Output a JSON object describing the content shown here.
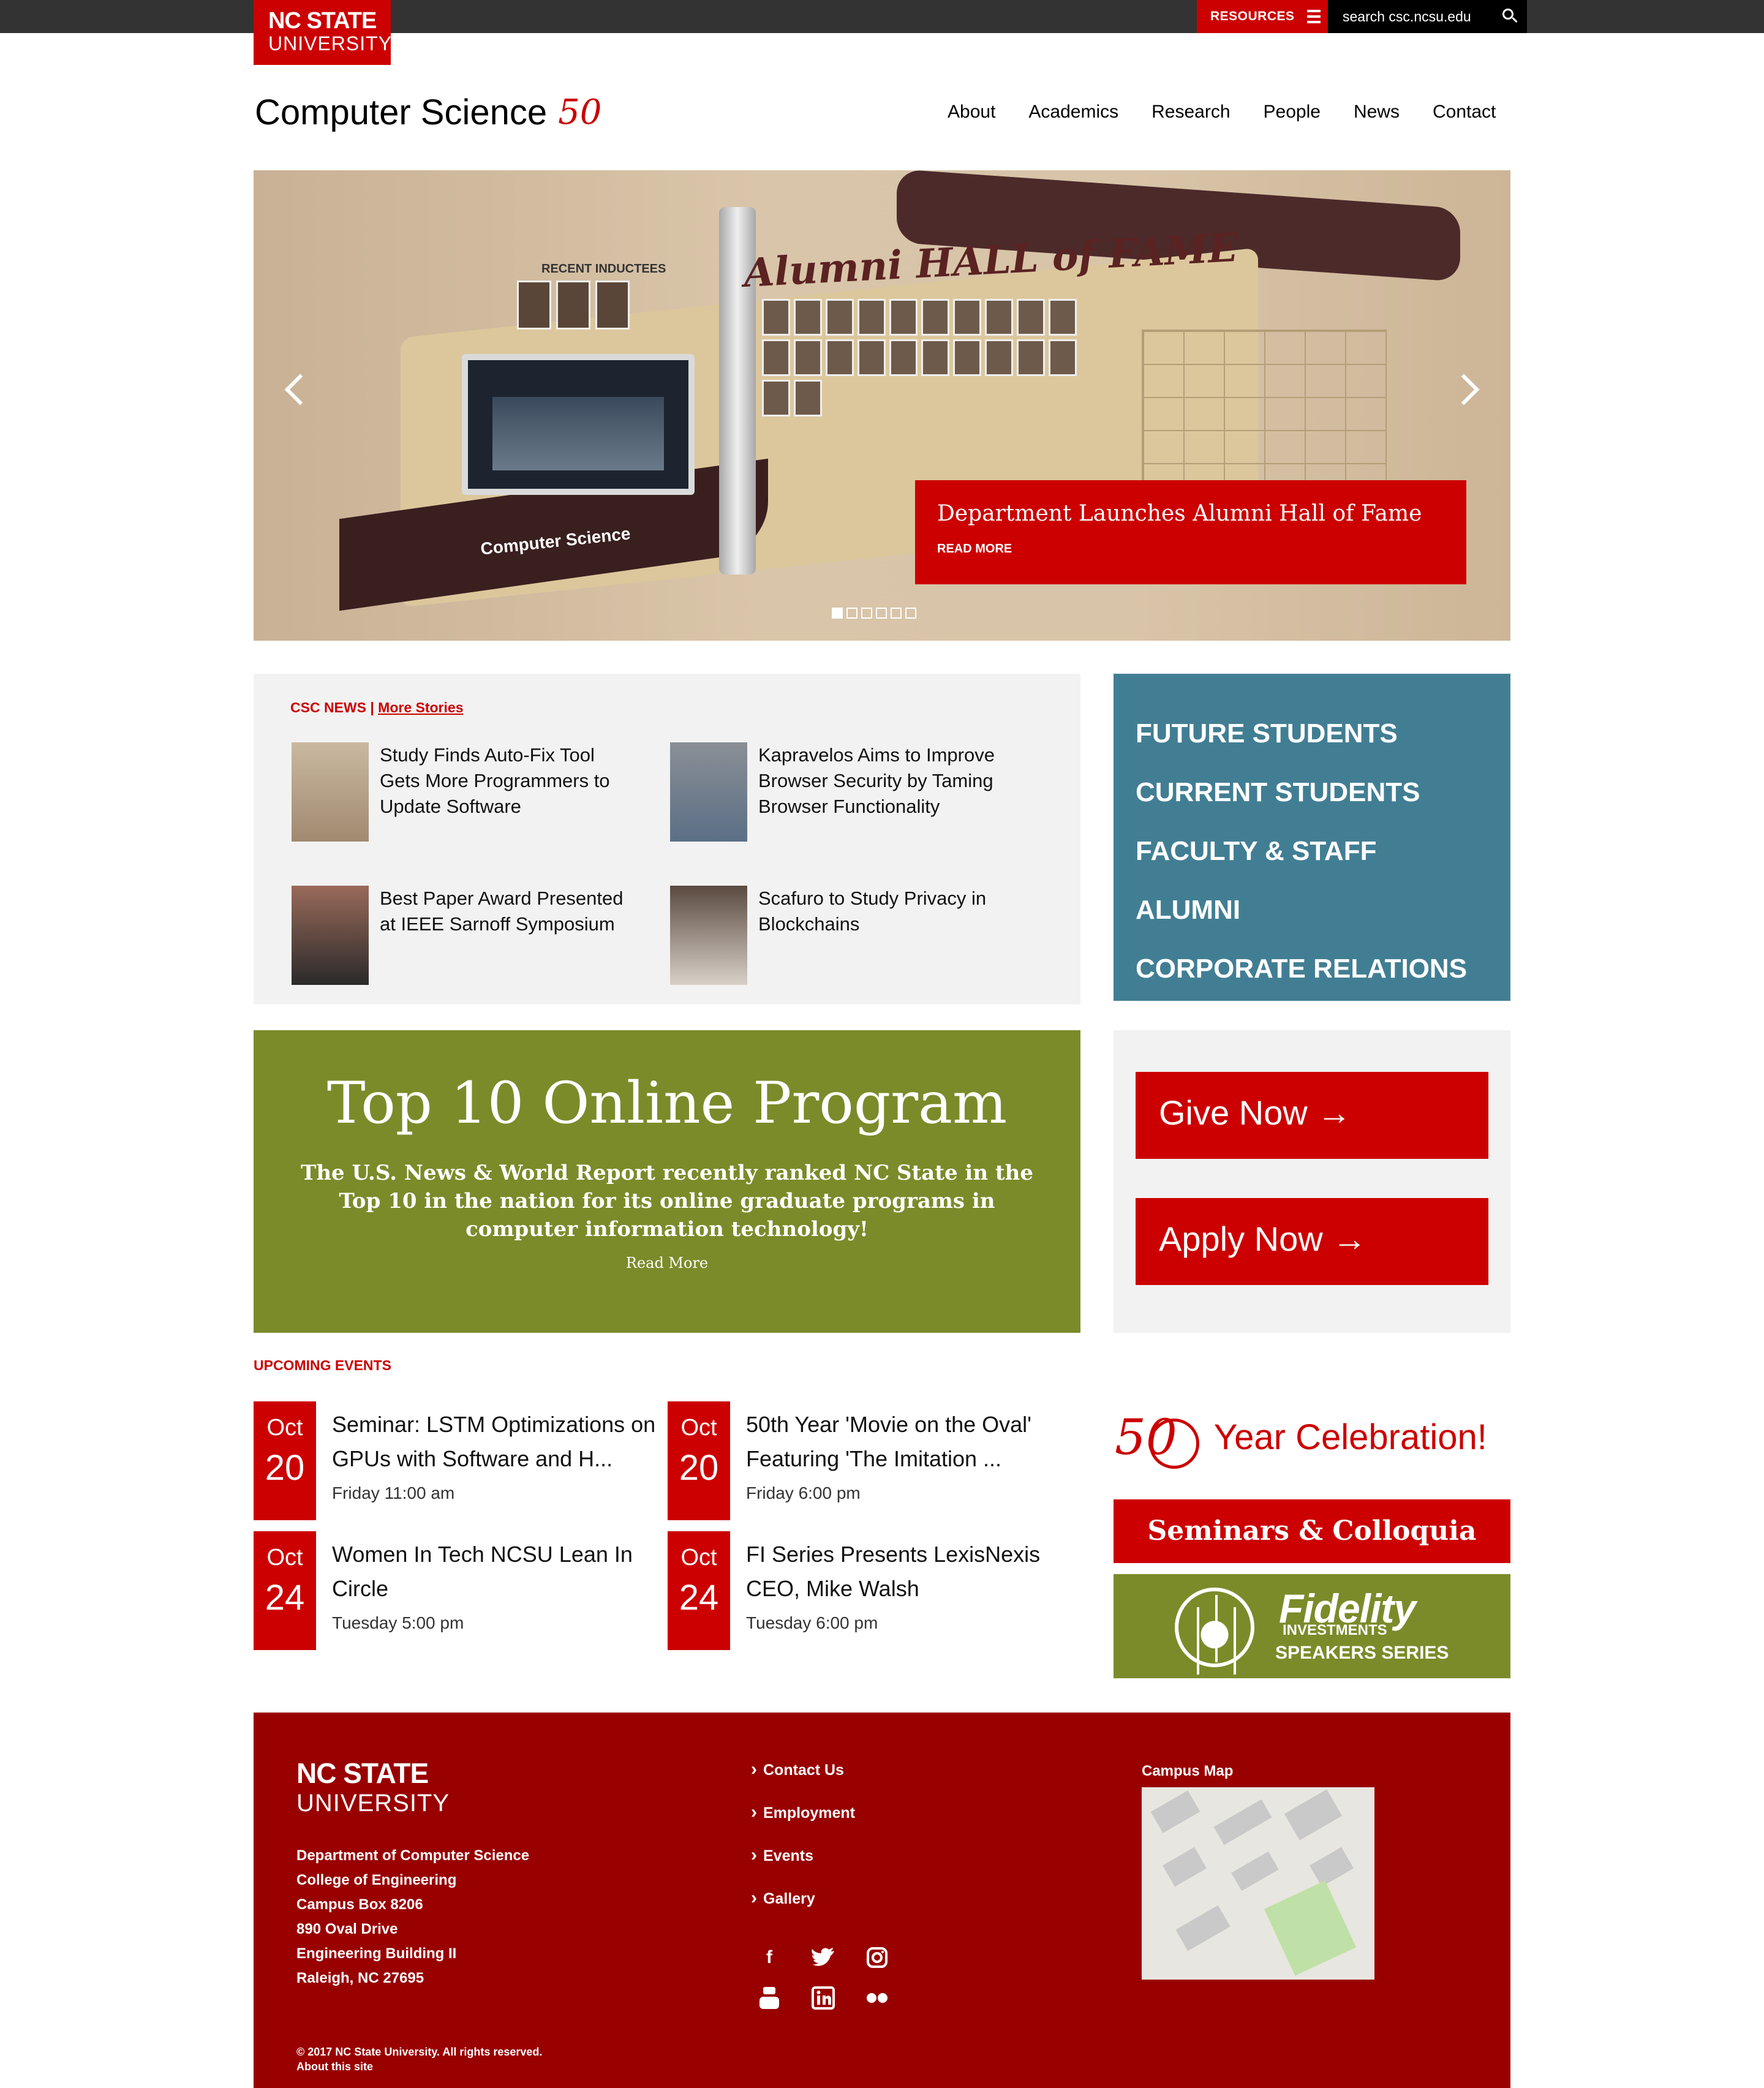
{
  "brand": {
    "line1": "NC STATE",
    "line2": "UNIVERSITY"
  },
  "topbar": {
    "resources_label": "RESOURCES",
    "search_placeholder": "search csc.ncsu.edu"
  },
  "site": {
    "title": "Computer Science",
    "anniversary": "50"
  },
  "nav": [
    "About",
    "Academics",
    "Research",
    "People",
    "News",
    "Contact"
  ],
  "hero": {
    "recent_label": "RECENT INDUCTEES",
    "hall_title": "Alumni HALL of FAME",
    "wall_label": "Computer Science",
    "caption_title": "Department Launches Alumni Hall of Fame",
    "caption_link": "READ MORE",
    "slide_count": 6,
    "active_slide": 1
  },
  "news": {
    "heading": "CSC NEWS",
    "separator": " | ",
    "more_link": "More Stories",
    "items": [
      {
        "title": "Study Finds Auto-Fix Tool Gets More Programmers to Update Software"
      },
      {
        "title": "Kapravelos Aims to Improve Browser Security by Taming Browser Functionality"
      },
      {
        "title": "Best Paper Award Presented at IEEE Sarnoff Symposium"
      },
      {
        "title": "Scafuro to Study Privacy in Blockchains"
      }
    ]
  },
  "audience": [
    "FUTURE STUDENTS",
    "CURRENT STUDENTS",
    "FACULTY & STAFF",
    "ALUMNI",
    "CORPORATE RELATIONS"
  ],
  "promo": {
    "title": "Top 10 Online Program",
    "body": "The U.S. News & World Report recently ranked NC State in the Top 10 in the nation for its online graduate programs in computer information technology!",
    "link": "Read More"
  },
  "cta": {
    "give": "Give Now →",
    "apply": "Apply Now →"
  },
  "events": {
    "heading": "UPCOMING EVENTS",
    "items": [
      {
        "month": "Oct",
        "day": "20",
        "title": "Seminar: LSTM Optimizations on GPUs with Software and H...",
        "time": "Friday 11:00 am"
      },
      {
        "month": "Oct",
        "day": "20",
        "title": "50th Year 'Movie on the Oval' Featuring 'The Imitation ...",
        "time": "Friday 6:00 pm"
      },
      {
        "month": "Oct",
        "day": "24",
        "title": "Women In Tech NCSU Lean In Circle",
        "time": "Tuesday 5:00 pm"
      },
      {
        "month": "Oct",
        "day": "24",
        "title": "FI Series Presents LexisNexis CEO, Mike Walsh",
        "time": "Tuesday 6:00 pm"
      }
    ]
  },
  "sidebar": {
    "celebration_num": "50",
    "celebration_text": "Year Celebration!",
    "seminars": "Seminars & Colloquia",
    "fidelity_brand": "Fidelity",
    "fidelity_sub": "INVESTMENTS",
    "fidelity_series": "SPEAKERS SERIES"
  },
  "footer": {
    "logo_line1": "NC STATE",
    "logo_line2": "UNIVERSITY",
    "address": [
      "Department of Computer Science",
      "College of Engineering",
      "Campus Box 8206",
      "890 Oval Drive",
      "Engineering Building II",
      "Raleigh, NC 27695"
    ],
    "links": [
      "Contact Us",
      "Employment",
      "Events",
      "Gallery"
    ],
    "social": [
      "facebook-icon",
      "twitter-icon",
      "instagram-icon",
      "youtube-icon",
      "linkedin-icon",
      "flickr-icon"
    ],
    "campus_map_label": "Campus Map",
    "copyright": "© 2017 NC State University. All rights reserved.",
    "about_link": "About this site"
  },
  "colors": {
    "brand_red": "#cc0000",
    "footer_red": "#990000",
    "audience_blue": "#427e93",
    "promo_green": "#7b8b2a",
    "panel_gray": "#f2f2f2",
    "topbar": "#333333"
  }
}
